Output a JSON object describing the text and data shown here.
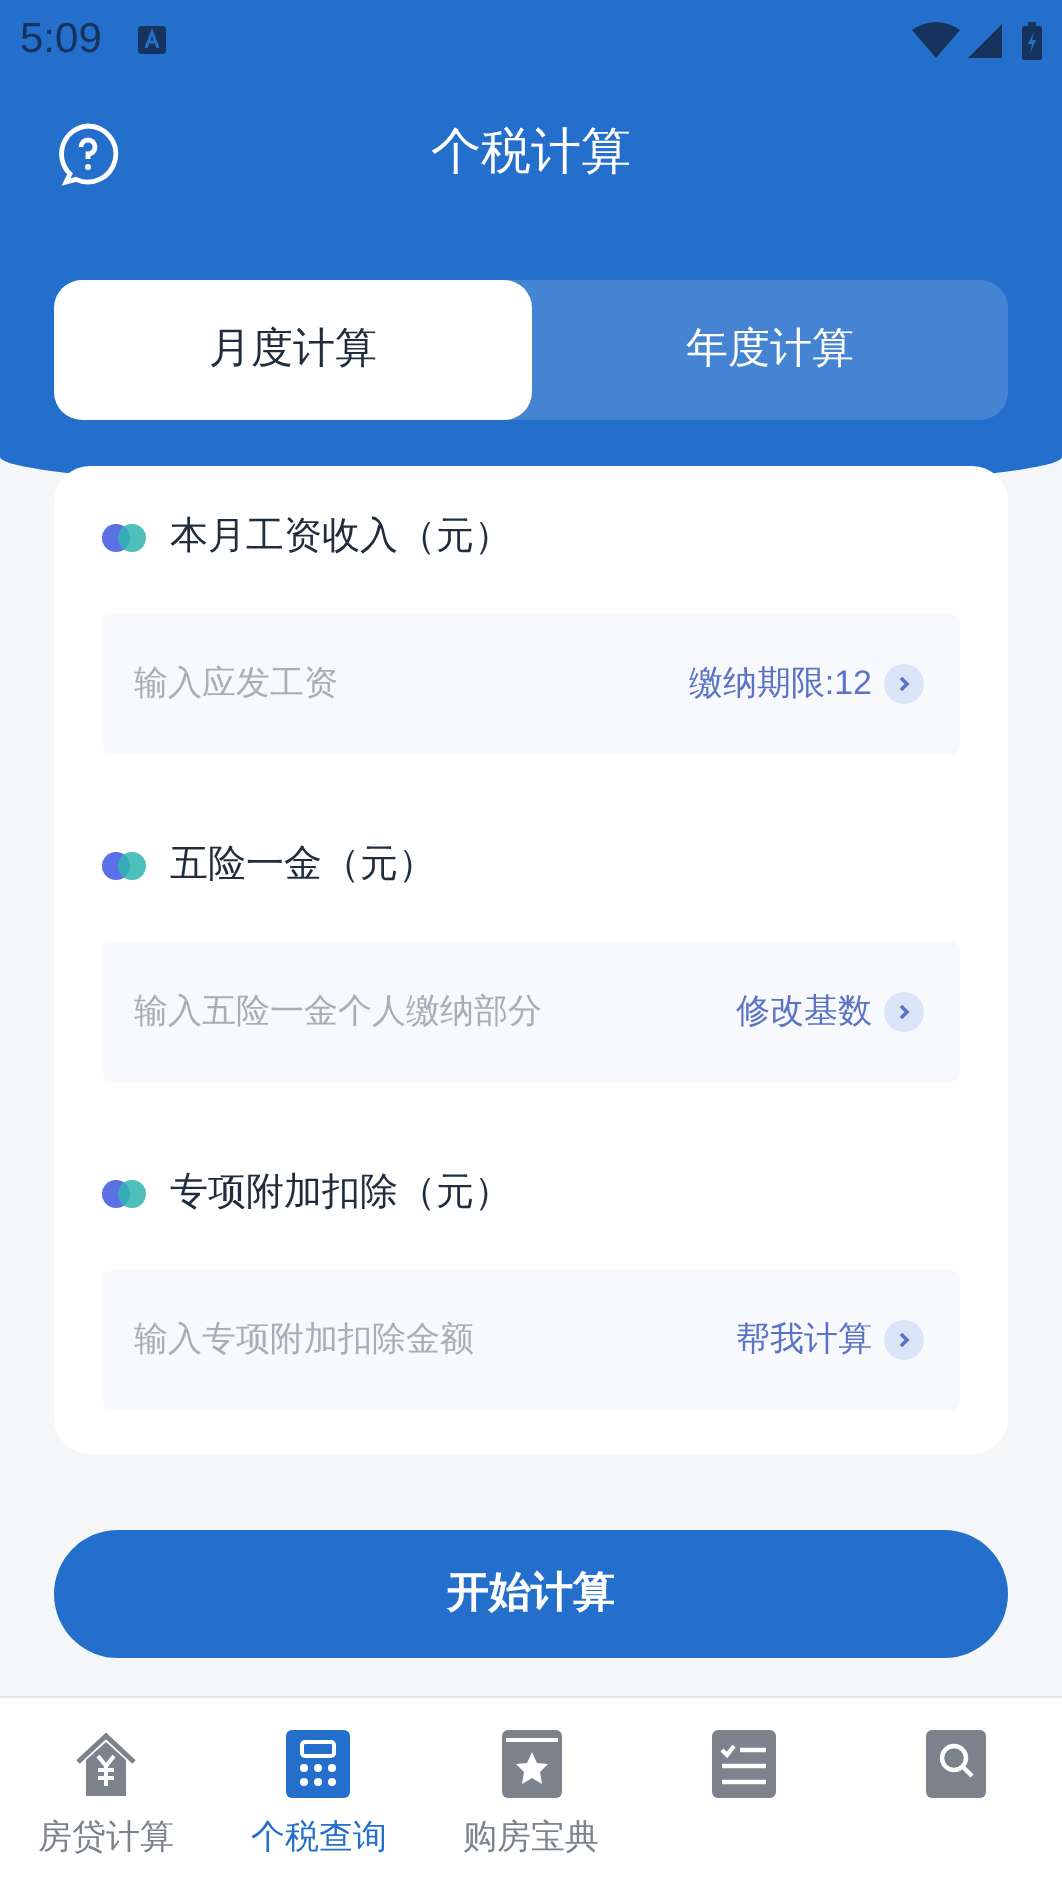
{
  "status_bar": {
    "time": "5:09"
  },
  "header": {
    "title": "个税计算"
  },
  "mode_tabs": [
    {
      "label": "月度计算",
      "selected": true
    },
    {
      "label": "年度计算",
      "selected": false
    }
  ],
  "sections": [
    {
      "title": "本月工资收入（元）",
      "placeholder": "输入应发工资",
      "action": "缴纳期限:12"
    },
    {
      "title": "五险一金（元）",
      "placeholder": "输入五险一金个人缴纳部分",
      "action": "修改基数"
    },
    {
      "title": "专项附加扣除（元）",
      "placeholder": "输入专项附加扣除金额",
      "action": "帮我计算"
    }
  ],
  "primary_button": "开始计算",
  "bottom_nav": [
    {
      "kind": "house",
      "label": "房贷计算",
      "selected": false
    },
    {
      "kind": "calculator",
      "label": "个税查询",
      "selected": true
    },
    {
      "kind": "book",
      "label": "购房宝典",
      "selected": false
    },
    {
      "kind": "list",
      "selected": false
    },
    {
      "kind": "search",
      "selected": false
    }
  ]
}
